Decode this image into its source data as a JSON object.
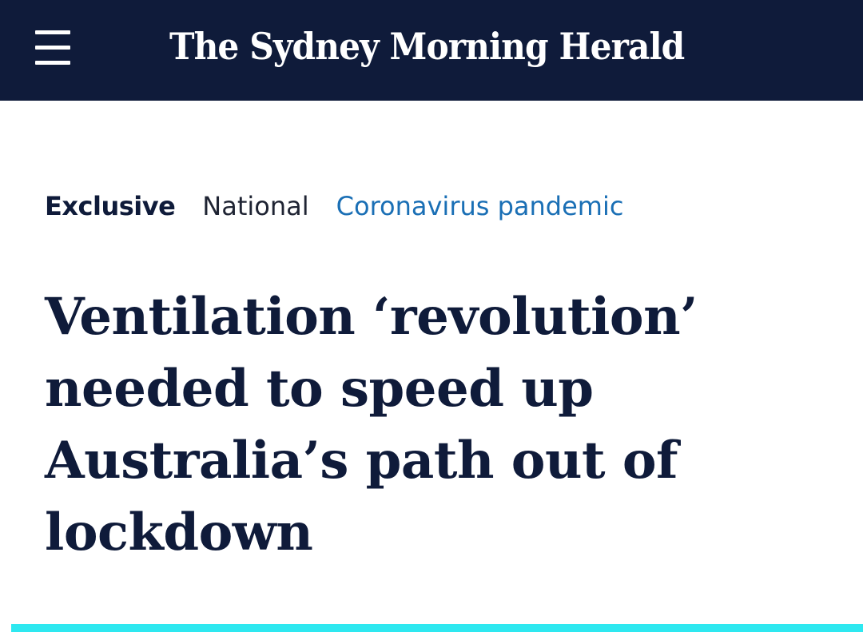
{
  "header": {
    "menu_icon": "hamburger-menu-icon",
    "masthead": "The Sydney Morning Herald",
    "background_color": "#0f1b3a"
  },
  "article": {
    "tags": {
      "exclusive": "Exclusive",
      "section": "National",
      "topic": "Coronavirus pandemic"
    },
    "headline": "Ventilation ‘revolution’ needed to speed up Australia’s path out of lockdown"
  },
  "colors": {
    "navy": "#0f1b3a",
    "link_blue": "#1a6fb5",
    "accent_cyan": "#2ee8f0"
  }
}
